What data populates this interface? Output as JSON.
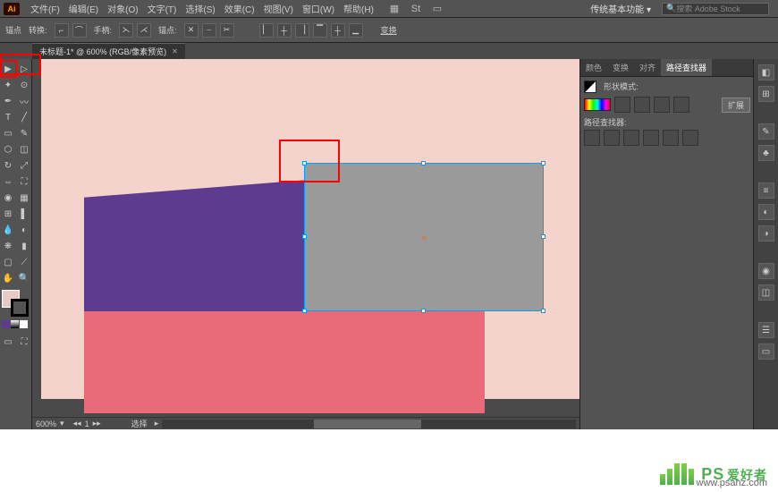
{
  "app": {
    "logo": "Ai",
    "menus": [
      {
        "label": "文件(F)"
      },
      {
        "label": "编辑(E)"
      },
      {
        "label": "对象(O)"
      },
      {
        "label": "文字(T)"
      },
      {
        "label": "选择(S)"
      },
      {
        "label": "效果(C)"
      },
      {
        "label": "视图(V)"
      },
      {
        "label": "窗口(W)"
      },
      {
        "label": "帮助(H)"
      }
    ],
    "workspace_selector": "传统基本功能",
    "search_placeholder": "搜索 Adobe Stock"
  },
  "control_bar": {
    "label_left": "锚点",
    "convert_label": "转换:",
    "handles_label": "手柄:",
    "anchors_label": "锚点:",
    "transform_label": "变换"
  },
  "document": {
    "tab_title": "未标题-1* @ 600% (RGB/像素预览)",
    "zoom": "600%",
    "page_num": "1",
    "status": "选择",
    "artboard_bg": "#f4d3cd",
    "shapes": {
      "purple": "#5d3b8e",
      "pink": "#e96a79",
      "selected_grey": "#9a9a9a"
    }
  },
  "panels": {
    "tabs": [
      "颜色",
      "变换",
      "对齐",
      "路径查找器"
    ],
    "active_tab": "路径查找器",
    "shape_mode_label": "形状模式:",
    "expand_btn": "扩展",
    "pathfinder_label": "路径查找器:"
  },
  "watermark": {
    "brand": "PS",
    "cn": "爱好者",
    "url": "www.psahz.com"
  }
}
